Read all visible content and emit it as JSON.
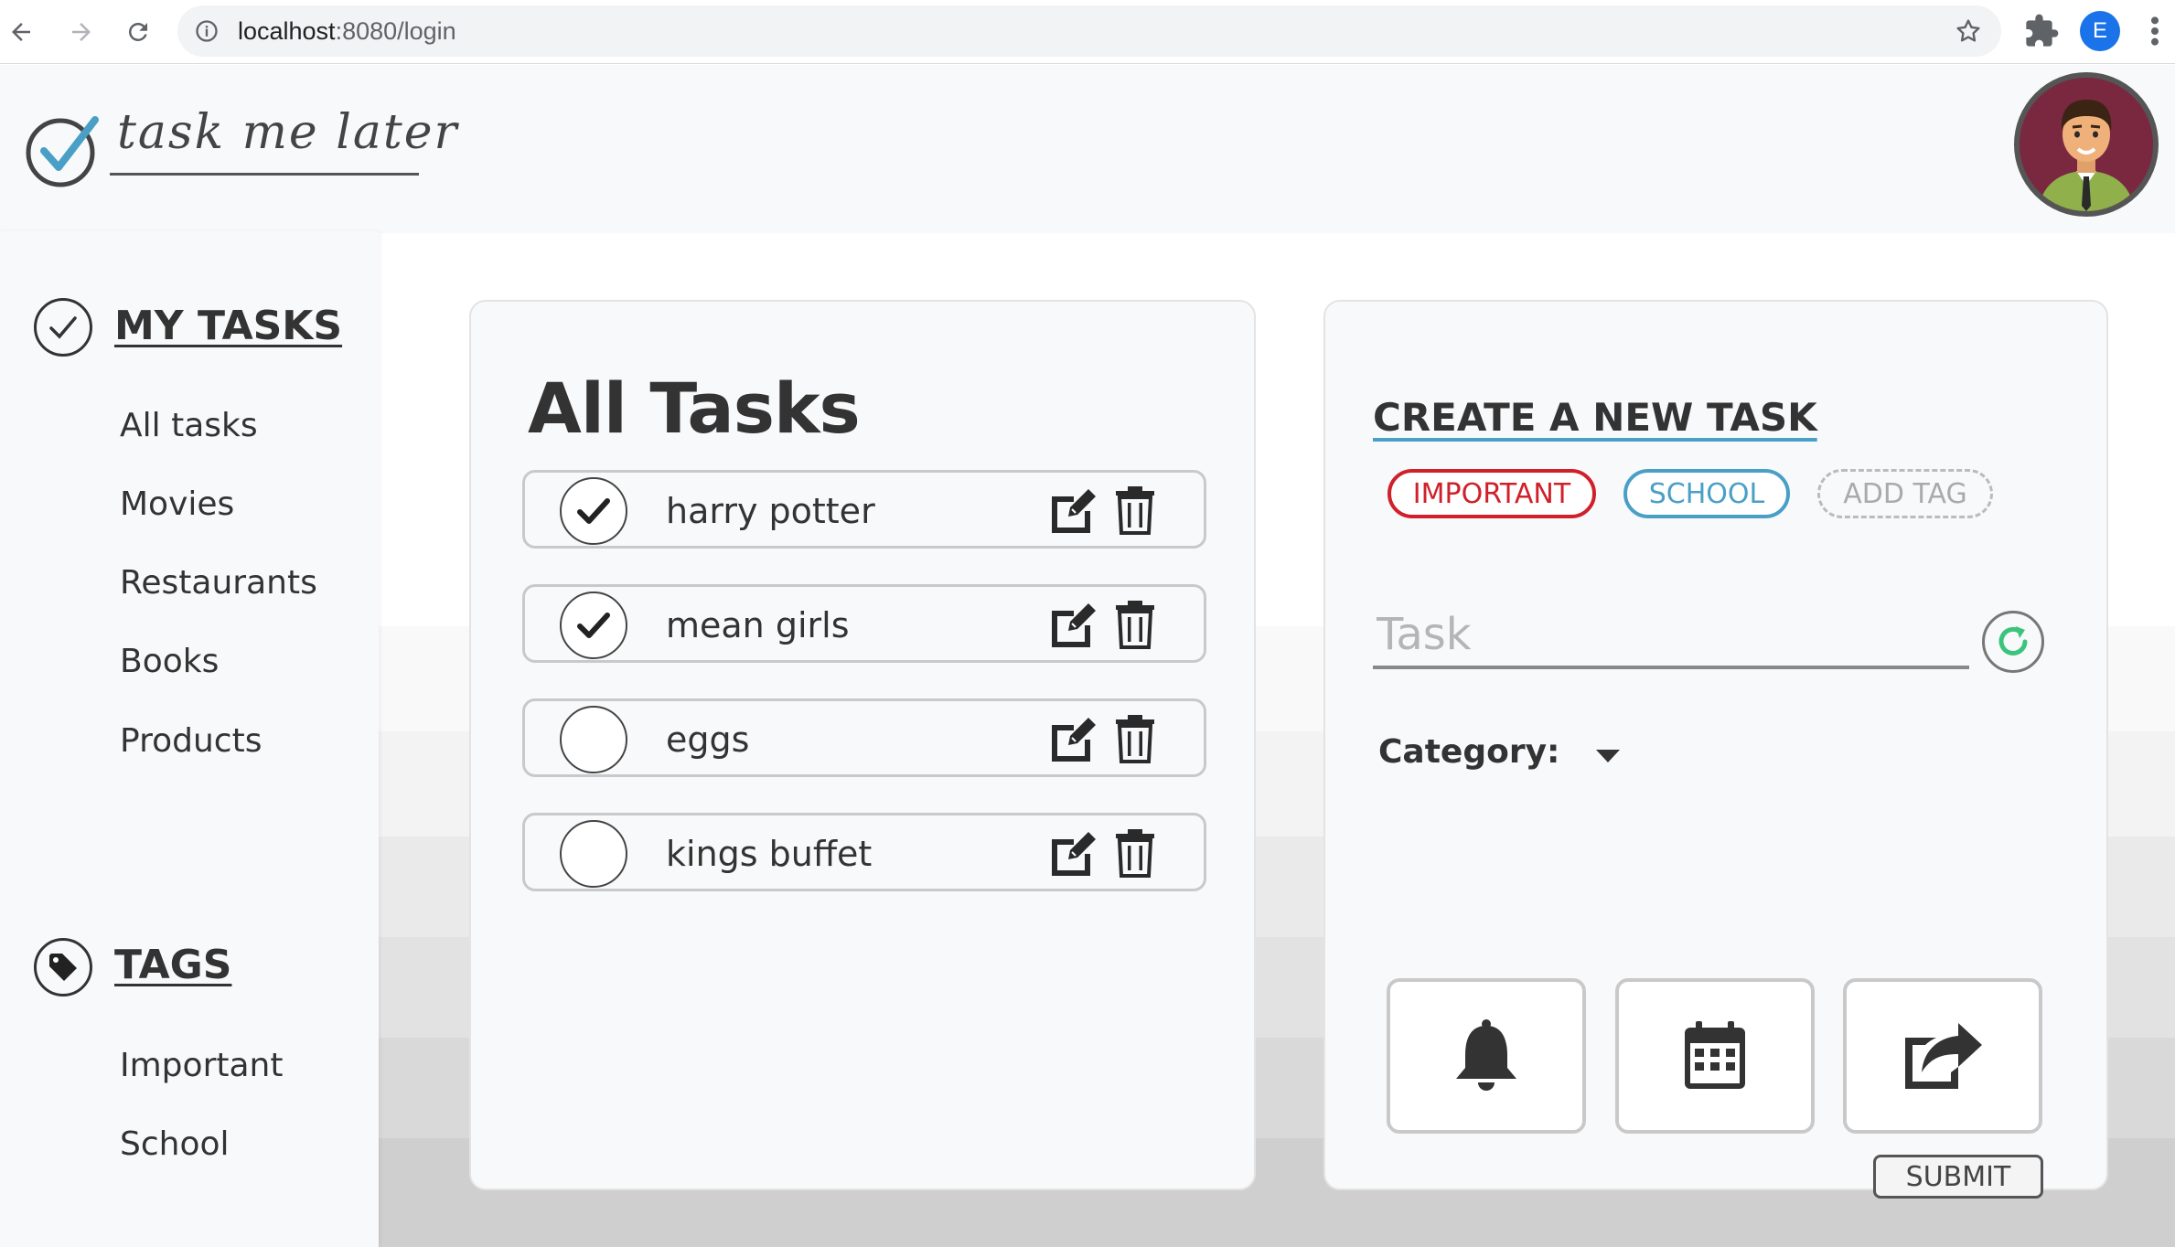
{
  "browser": {
    "url_host": "localhost",
    "url_path": ":8080/login",
    "profile_initial": "E"
  },
  "header": {
    "logo_text": "task me later",
    "icons": [
      "logo-check-icon",
      "avatar"
    ]
  },
  "sidebar": {
    "my_tasks_title": "MY TASKS",
    "task_items": [
      {
        "label": "All tasks"
      },
      {
        "label": "Movies"
      },
      {
        "label": "Restaurants"
      },
      {
        "label": "Books"
      },
      {
        "label": "Products"
      }
    ],
    "tags_title": "TAGS",
    "tag_items": [
      {
        "label": "Important"
      },
      {
        "label": "School"
      }
    ]
  },
  "tasks_panel": {
    "title": "All Tasks",
    "tasks": [
      {
        "label": "harry potter",
        "done": true
      },
      {
        "label": "mean girls",
        "done": true
      },
      {
        "label": "eggs",
        "done": false
      },
      {
        "label": "kings buffet",
        "done": false
      }
    ]
  },
  "create_panel": {
    "title": "CREATE A NEW TASK",
    "tags": [
      {
        "label": "IMPORTANT",
        "color": "#d0202a"
      },
      {
        "label": "SCHOOL",
        "color": "#4a9fc6"
      },
      {
        "label": "ADD TAG",
        "color": "#aaaaaa"
      }
    ],
    "task_placeholder": "Task",
    "task_value": "",
    "category_label": "Category:",
    "category_value": "",
    "action_icons": [
      "bell-icon",
      "calendar-icon",
      "share-icon"
    ],
    "submit_label": "SUBMIT"
  },
  "colors": {
    "accent_blue": "#4a9fc6",
    "important_red": "#d0202a",
    "refresh_green": "#3cc47c",
    "text_dark": "#333333"
  }
}
